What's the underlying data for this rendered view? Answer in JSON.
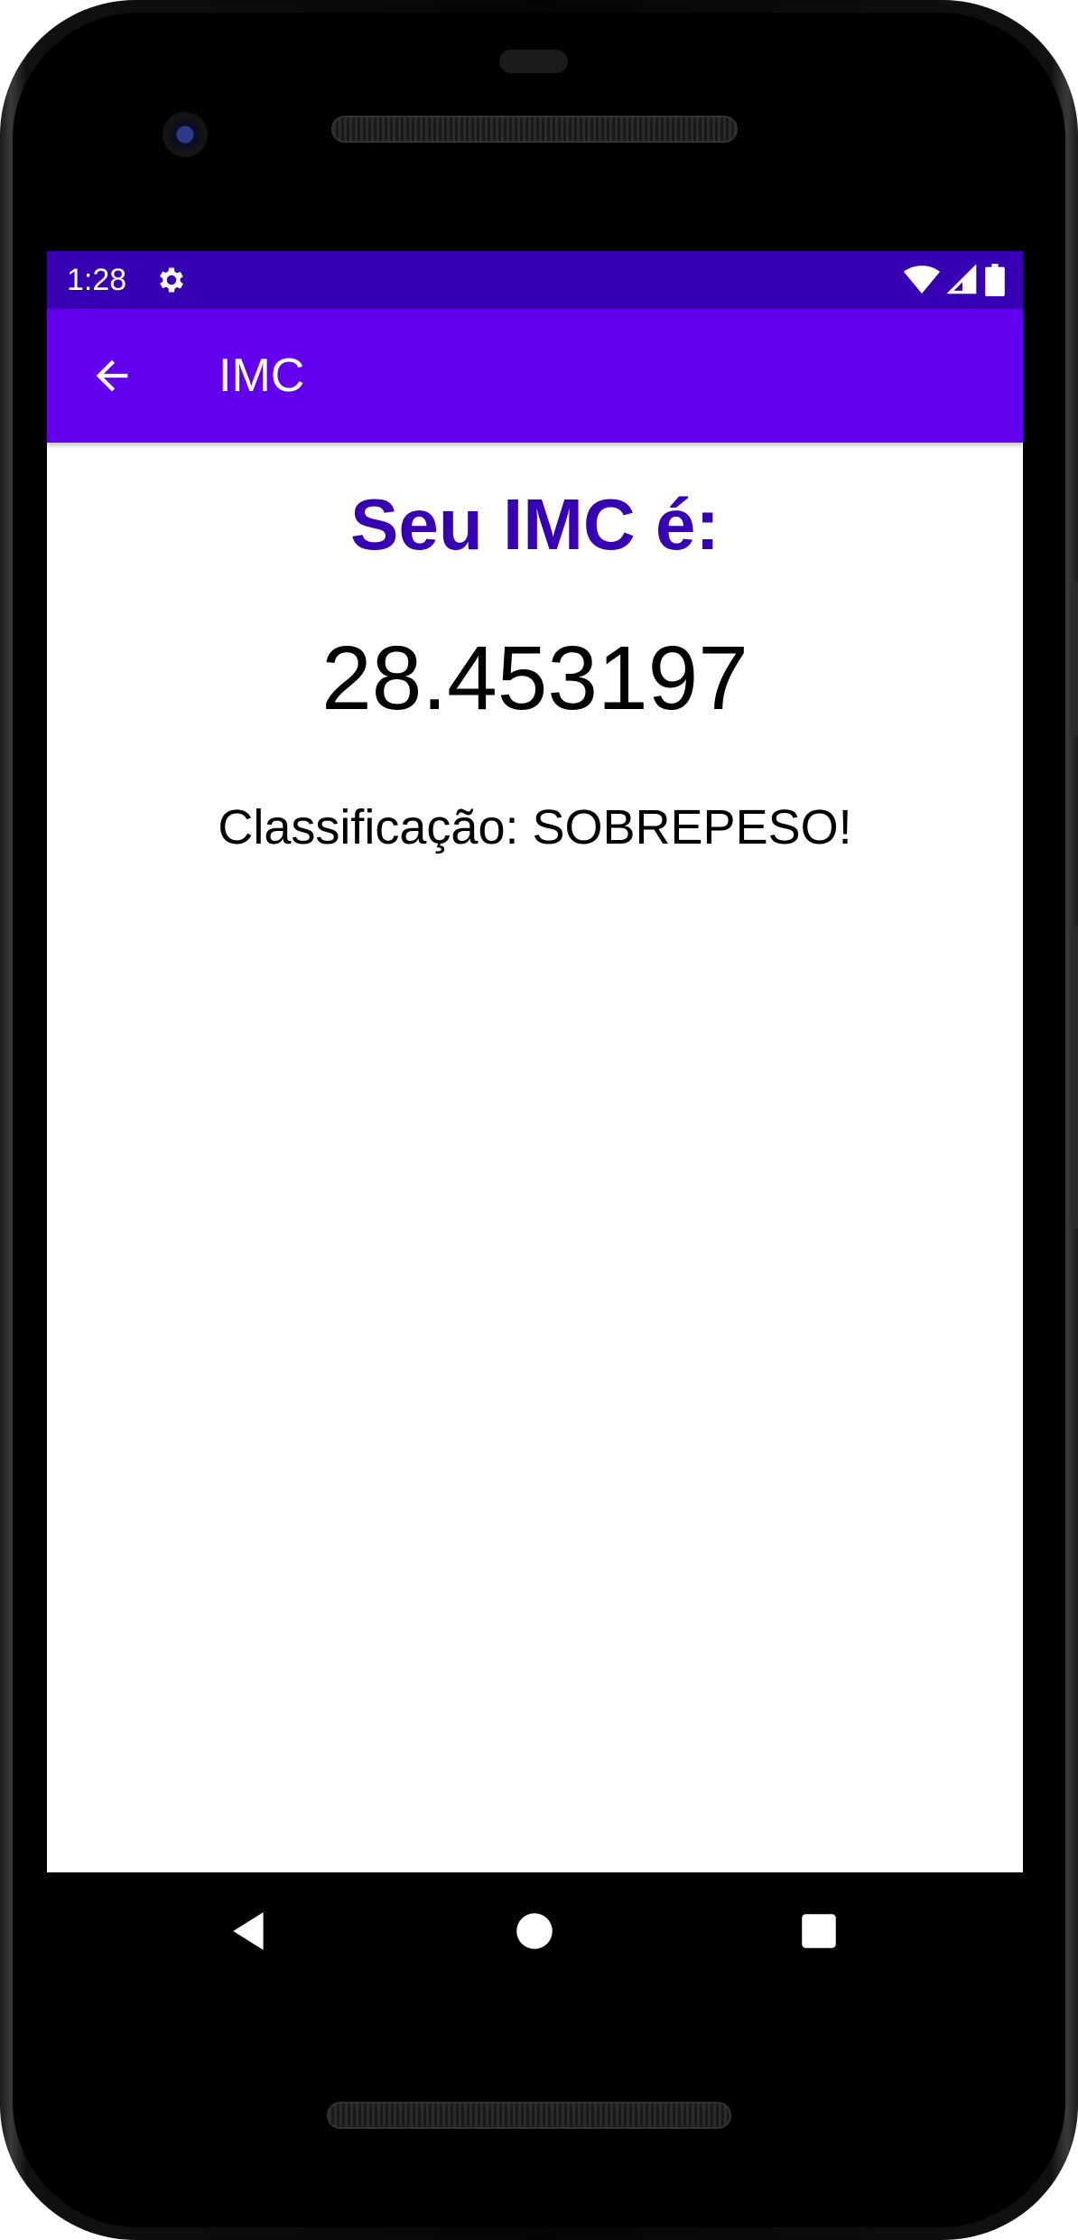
{
  "status_bar": {
    "time": "1:28",
    "icons": [
      "settings-icon",
      "wifi-icon",
      "signal-icon",
      "battery-icon"
    ],
    "background": "#3700b3"
  },
  "app_bar": {
    "title": "IMC",
    "back_icon": "arrow-back-icon",
    "background": "#6200ee"
  },
  "result": {
    "heading": "Seu IMC é:",
    "value": "28.453197",
    "classification": "Classificação: SOBREPESO!",
    "heading_color": "#3700b3"
  },
  "nav_bar": {
    "buttons": [
      "back-triangle-icon",
      "home-circle-icon",
      "recents-square-icon"
    ]
  }
}
